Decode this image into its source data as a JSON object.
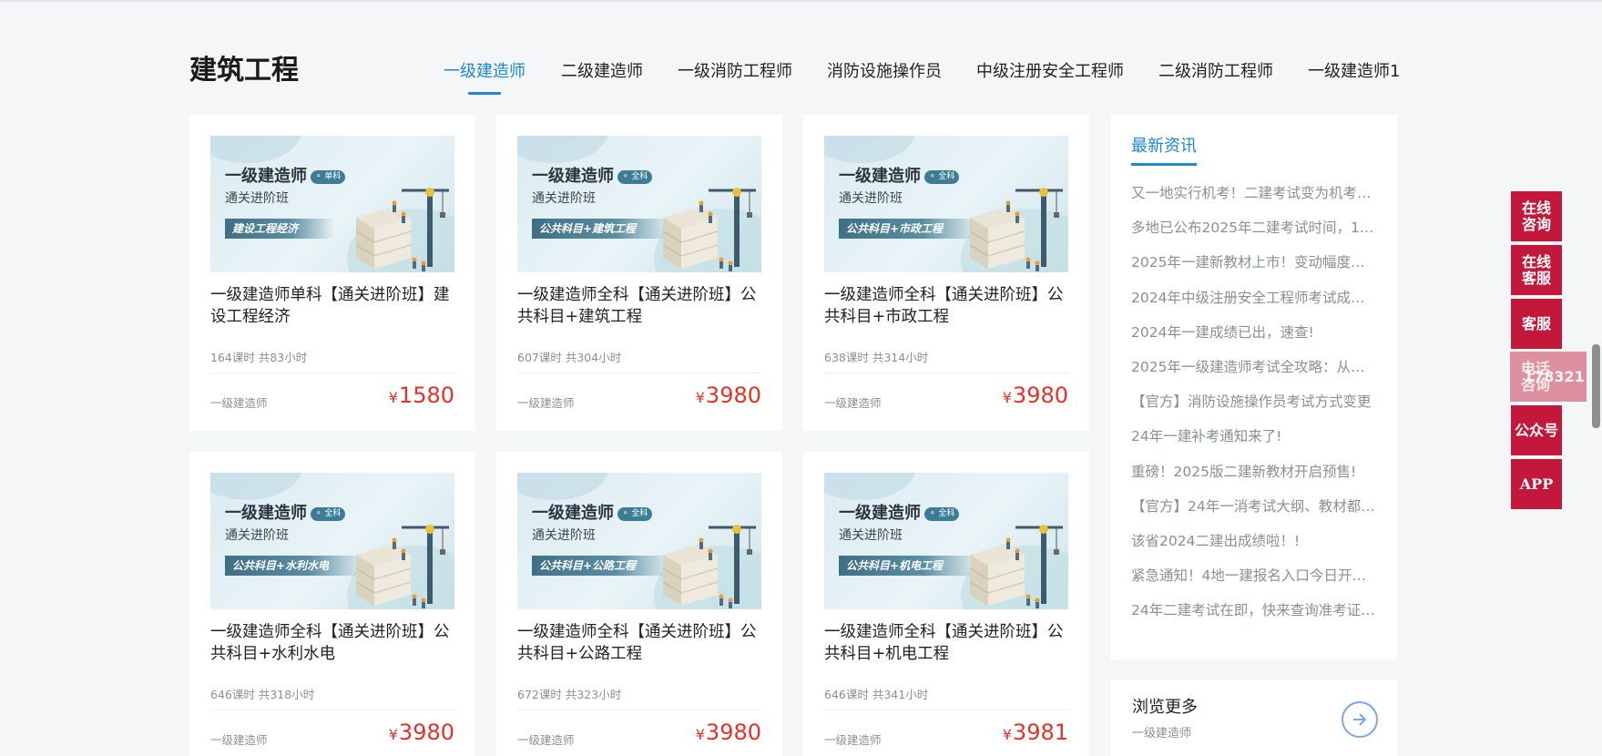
{
  "header": {
    "title": "建筑工程",
    "tabs": [
      {
        "label": "一级建造师",
        "active": true
      },
      {
        "label": "二级建造师",
        "active": false
      },
      {
        "label": "一级消防工程师",
        "active": false
      },
      {
        "label": "消防设施操作员",
        "active": false
      },
      {
        "label": "中级注册安全工程师",
        "active": false
      },
      {
        "label": "二级消防工程师",
        "active": false
      },
      {
        "label": "一级建造师1",
        "active": false
      }
    ]
  },
  "courses": [
    {
      "img_title": "一级建造师",
      "img_badge": "单科",
      "img_sub": "通关进阶班",
      "img_ribbon": "建设工程经济",
      "title": "一级建造师单科【通关进阶班】建设工程经济",
      "hours": "164课时 共83小时",
      "category": "一级建造师",
      "currency": "¥",
      "price": "1580"
    },
    {
      "img_title": "一级建造师",
      "img_badge": "全科",
      "img_sub": "通关进阶班",
      "img_ribbon": "公共科目+建筑工程",
      "title": "一级建造师全科【通关进阶班】公共科目+建筑工程",
      "hours": "607课时 共304小时",
      "category": "一级建造师",
      "currency": "¥",
      "price": "3980"
    },
    {
      "img_title": "一级建造师",
      "img_badge": "全科",
      "img_sub": "通关进阶班",
      "img_ribbon": "公共科目+市政工程",
      "title": "一级建造师全科【通关进阶班】公共科目+市政工程",
      "hours": "638课时 共314小时",
      "category": "一级建造师",
      "currency": "¥",
      "price": "3980"
    },
    {
      "img_title": "一级建造师",
      "img_badge": "全科",
      "img_sub": "通关进阶班",
      "img_ribbon": "公共科目+水利水电",
      "title": "一级建造师全科【通关进阶班】公共科目+水利水电",
      "hours": "646课时 共318小时",
      "category": "一级建造师",
      "currency": "¥",
      "price": "3980"
    },
    {
      "img_title": "一级建造师",
      "img_badge": "全科",
      "img_sub": "通关进阶班",
      "img_ribbon": "公共科目+公路工程",
      "title": "一级建造师全科【通关进阶班】公共科目+公路工程",
      "hours": "672课时 共323小时",
      "category": "一级建造师",
      "currency": "¥",
      "price": "3980"
    },
    {
      "img_title": "一级建造师",
      "img_badge": "全科",
      "img_sub": "通关进阶班",
      "img_ribbon": "公共科目+机电工程",
      "title": "一级建造师全科【通关进阶班】公共科目+机电工程",
      "hours": "646课时 共341小时",
      "category": "一级建造师",
      "currency": "¥",
      "price": "3981"
    }
  ],
  "news": {
    "heading": "最新资讯",
    "items": [
      "又一地实行机考！二建考试变为机考…",
      "多地已公布2025年二建考试时间，1…",
      "2025年一建新教材上市！变动幅度…",
      "2024年中级注册安全工程师考试成…",
      "2024年一建成绩已出，速查!",
      "2025年一级建造师考试全攻略：从…",
      "【官方】消防设施操作员考试方式变更",
      "24年一建补考通知来了!",
      "重磅！2025版二建新教材开启预售!",
      "【官方】24年一消考试大纲、教材都…",
      "该省2024二建出成绩啦！!",
      "紧急通知！4地一建报名入口今日开…",
      "24年二建考试在即，快来查询准考证…"
    ]
  },
  "browse_more": {
    "title": "浏览更多",
    "subtitle": "一级建造师",
    "icon": "arrow-right-circle-icon",
    "accent": "#7aa8e6"
  },
  "float_bar": {
    "online_consult": "在线咨询",
    "online_service": "在线客服",
    "service": "客服",
    "phone_consult": "电话咨询",
    "phone_number_partial": "178321",
    "official_account": "公众号",
    "app": "APP",
    "color": "#c4173c"
  },
  "colors": {
    "accent": "#1e86d6",
    "price": "#e6302a",
    "background": "#f5f6f8"
  }
}
